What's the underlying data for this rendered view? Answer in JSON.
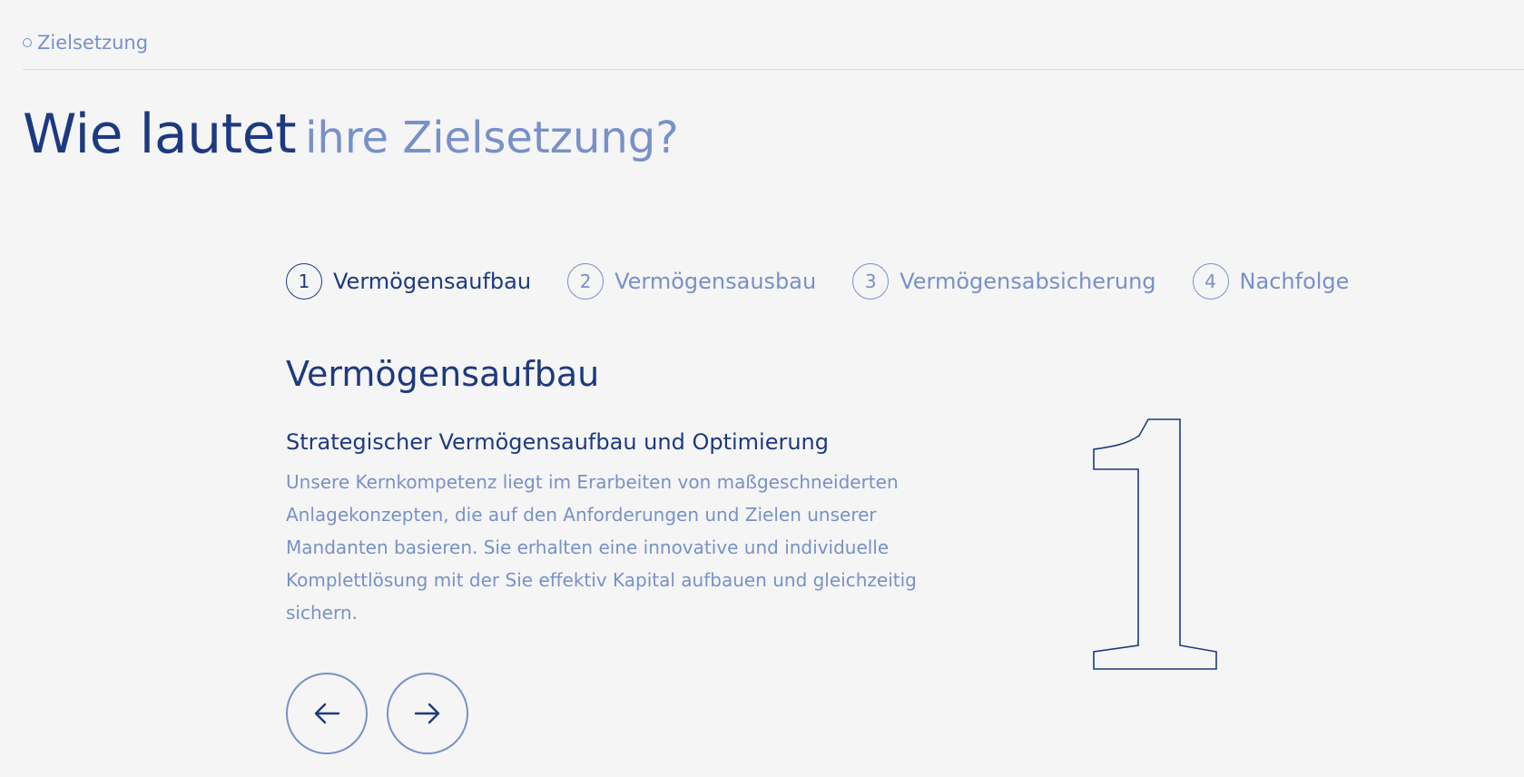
{
  "breadcrumb": {
    "label": "Zielsetzung",
    "icon": "circle-outline-icon"
  },
  "heading": {
    "strong": "Wie lautet",
    "soft": "ihre Zielsetzung?"
  },
  "steps": [
    {
      "number": "1",
      "label": "Vermögensaufbau",
      "active": true
    },
    {
      "number": "2",
      "label": "Vermögensausbau",
      "active": false
    },
    {
      "number": "3",
      "label": "Vermögensabsicherung",
      "active": false
    },
    {
      "number": "4",
      "label": "Nachfolge",
      "active": false
    }
  ],
  "content": {
    "title": "Vermögensaufbau",
    "subtitle": "Strategischer Vermögensaufbau und Optimierung",
    "body": "Unsere Kernkompetenz liegt im Erarbeiten von maßgeschneiderten Anlagekonzepten, die auf den Anforderungen und Zielen unserer Mandanten basieren. Sie erhalten eine innovative und individuelle Komplettlösung mit der Sie effektiv Kapital aufbauen und gleichzeitig sichern.",
    "big_number": "1"
  },
  "navigation": {
    "prev_icon": "arrow-left-icon",
    "next_icon": "arrow-right-icon"
  },
  "colors": {
    "background": "#f5f5f5",
    "primary": "#1d3a80",
    "secondary": "#7891c8",
    "divider": "#dcdcdc"
  }
}
